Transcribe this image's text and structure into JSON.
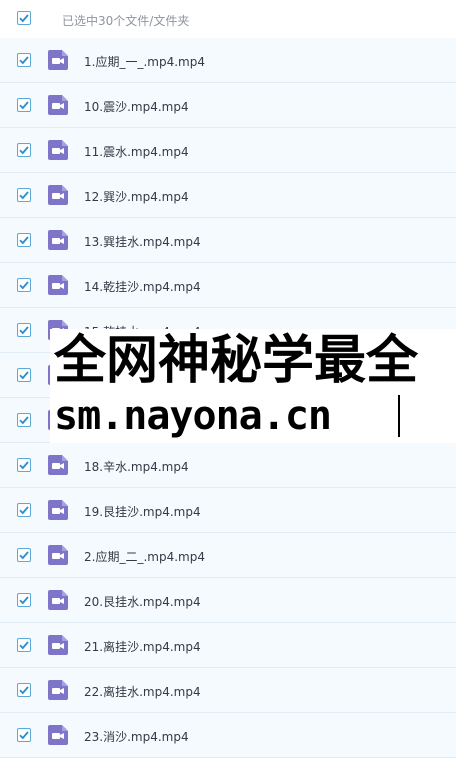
{
  "header": {
    "select_label": "已选中30个文件/文件夹"
  },
  "colors": {
    "accent": "#2b8dd1",
    "row_bg": "#f5fafe",
    "video_icon": "#7e75c9"
  },
  "icons": {
    "checkbox": "checkbox-checked-icon",
    "file": "video-file-icon"
  },
  "files": [
    {
      "name": "1.应期_一_.mp4.mp4"
    },
    {
      "name": "10.震沙.mp4.mp4"
    },
    {
      "name": "11.震水.mp4.mp4"
    },
    {
      "name": "12.巽沙.mp4.mp4"
    },
    {
      "name": "13.巽挂水.mp4.mp4"
    },
    {
      "name": "14.乾挂沙.mp4.mp4"
    },
    {
      "name": "15.乾挂水.mp4.mp4"
    },
    {
      "name": ""
    },
    {
      "name": ""
    },
    {
      "name": "18.辛水.mp4.mp4"
    },
    {
      "name": "19.艮挂沙.mp4.mp4"
    },
    {
      "name": "2.应期_二_.mp4.mp4"
    },
    {
      "name": "20.艮挂水.mp4.mp4"
    },
    {
      "name": "21.离挂沙.mp4.mp4"
    },
    {
      "name": "22.离挂水.mp4.mp4"
    },
    {
      "name": "23.消沙.mp4.mp4"
    }
  ],
  "watermark": {
    "line1": "全网神秘学最全",
    "line2": "sm.nayona.cn"
  }
}
